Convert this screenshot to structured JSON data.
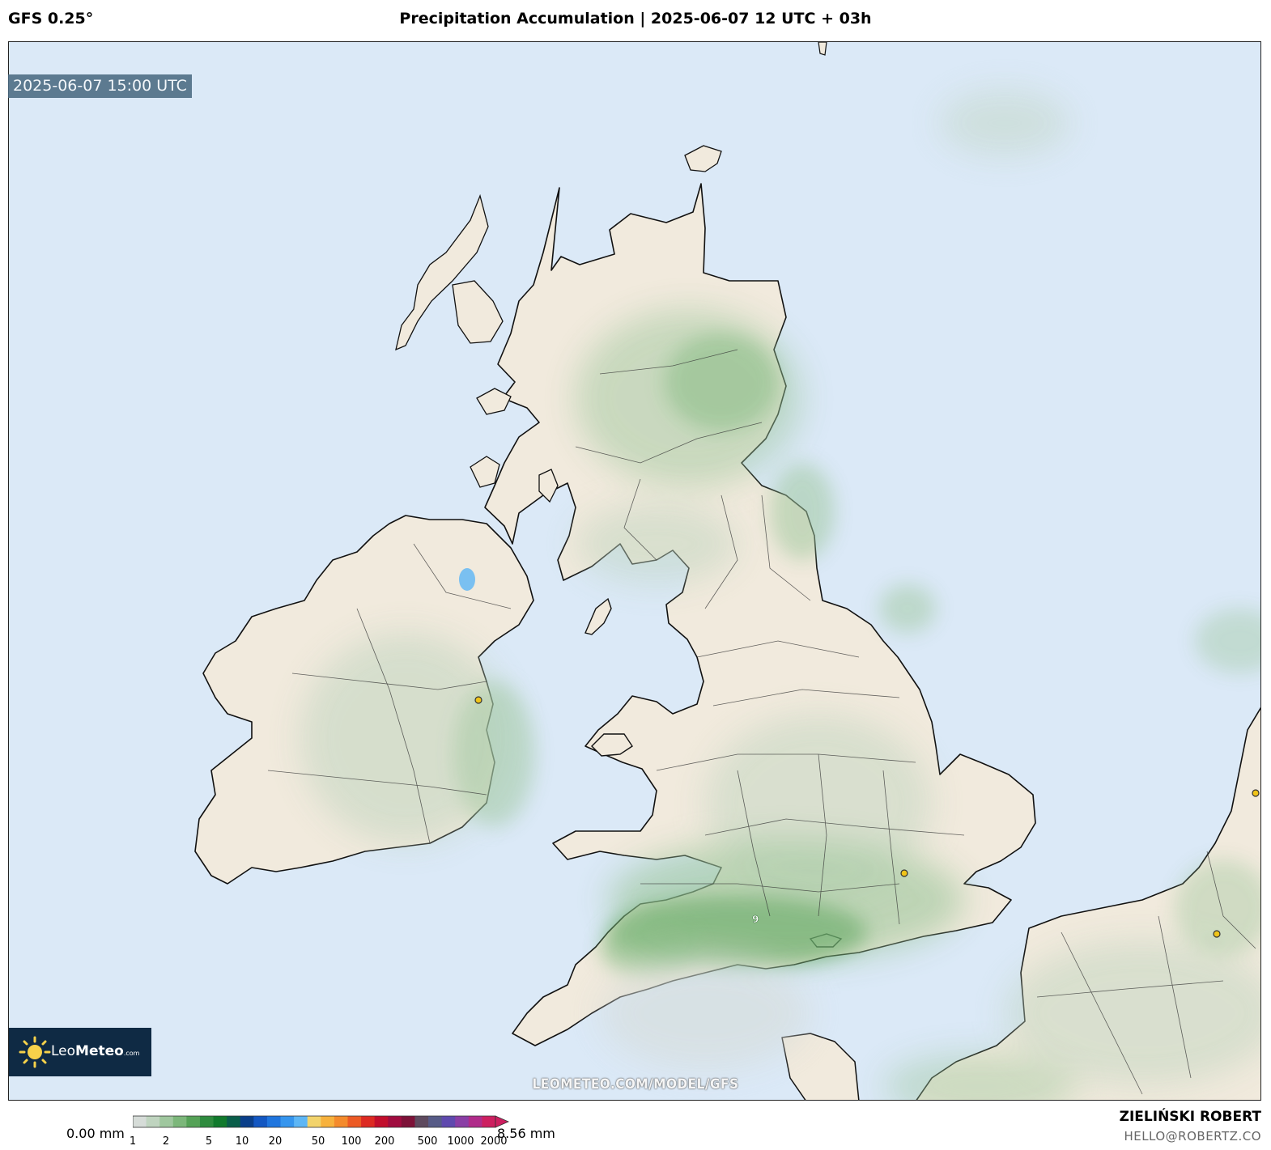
{
  "header": {
    "model": "GFS 0.25°",
    "title": "Precipitation Accumulation | 2025-06-07 12 UTC + 03h"
  },
  "map": {
    "valid_time": "2025-06-07 15:00 UTC",
    "watermark": "LEOMETEO.COM/MODEL/GFS",
    "max_marker_label": "9",
    "region": "British Isles and north-western Europe",
    "colors": {
      "sea": "#dbe9f7",
      "land": "#f1eadd",
      "coastline": "#111111"
    }
  },
  "logo": {
    "name_light": "Leo",
    "name_bold": "Meteo",
    "suffix": ".com"
  },
  "colorbar": {
    "min_label": "0.00 mm",
    "max_label": "8.56 mm",
    "ticks": [
      "1",
      "2",
      "5",
      "10",
      "20",
      "50",
      "100",
      "200",
      "500",
      "1000",
      "2000"
    ],
    "colors": [
      "#d6dcd8",
      "#bfd4bf",
      "#9fc79e",
      "#7cb77a",
      "#55a257",
      "#2e8b3e",
      "#117a2c",
      "#0a5e4a",
      "#0a3f8a",
      "#1357c2",
      "#1f75de",
      "#3595ee",
      "#5db6f5",
      "#f2d36b",
      "#f7b13c",
      "#f48a2b",
      "#ec5a24",
      "#dd2a22",
      "#c20e2c",
      "#a00c3f",
      "#7d1238",
      "#5e4a5f",
      "#575b87",
      "#5f49ae",
      "#8a3ea5",
      "#b02b8a",
      "#cd1f60"
    ]
  },
  "footer": {
    "author": "ZIELIŃSKI ROBERT",
    "email": "HELLO@ROBERTZ.CO"
  }
}
